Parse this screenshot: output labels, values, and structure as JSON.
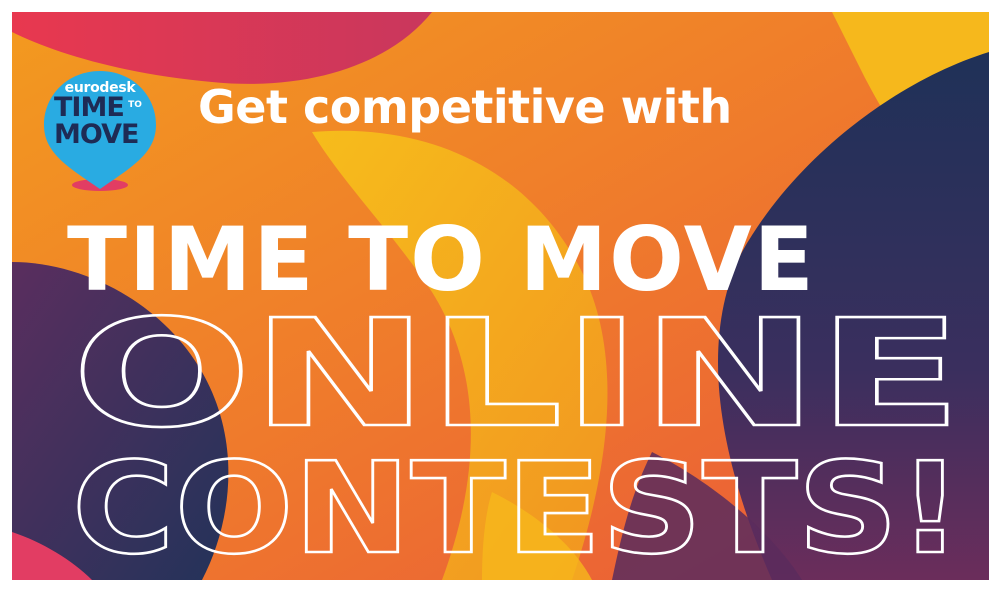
{
  "logo": {
    "brand": "eurodesk",
    "line1": "TIME",
    "connector": "TO",
    "line2": "MOVE",
    "icon": "map-pin-icon",
    "pin_color": "#29abe2",
    "text_color": "#1e2b55"
  },
  "headline": "Get competitive with",
  "title": "TIME TO MOVE",
  "outline_line1": "ONLINE",
  "outline_line2": "CONTESTS!",
  "colors": {
    "orange": "#f0822a",
    "yellow": "#f5b31c",
    "red": "#e94b3c",
    "pink": "#e23d63",
    "navy": "#22315a",
    "purple": "#6a2f5e"
  }
}
